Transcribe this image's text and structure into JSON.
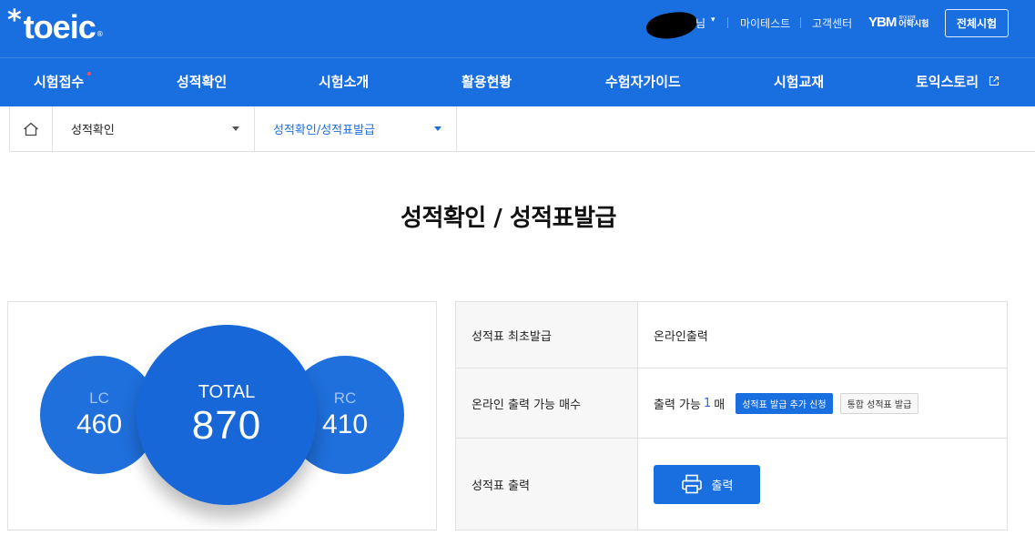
{
  "header": {
    "logo_text": "toeic",
    "logo_star": "*",
    "logo_reg": "®",
    "user_suffix": "님",
    "user_caret": "▾",
    "links": [
      "마이테스트",
      "고객센터"
    ],
    "ybm_mark": "YBM",
    "ybm_small": "와이비엠",
    "ybm_label": "어학시험",
    "all_exams_button": "전체시험"
  },
  "nav": {
    "items": [
      {
        "label": "시험접수",
        "dot": true
      },
      {
        "label": "성적확인"
      },
      {
        "label": "시험소개"
      },
      {
        "label": "활용현황"
      },
      {
        "label": "수험자가이드"
      },
      {
        "label": "시험교재"
      },
      {
        "label": "토익스토리",
        "external": true
      }
    ]
  },
  "breadcrumb": {
    "level1": "성적확인",
    "level2": "성적확인/성적표발급"
  },
  "page": {
    "title": "성적확인 / 성적표발급"
  },
  "scores": {
    "lc_label": "LC",
    "lc_score": "460",
    "total_label": "TOTAL",
    "total_score": "870",
    "rc_label": "RC",
    "rc_score": "410"
  },
  "info": {
    "row1_label": "성적표 최초발급",
    "row1_value": "온라인출력",
    "row2_label": "온라인 출력 가능 매수",
    "row2_prefix": "출력 가능",
    "row2_count": "1",
    "row2_unit": "매",
    "add_request_button": "성적표 발급 추가 신청",
    "integrated_button": "통합 성적표 발급",
    "row3_label": "성적표 출력",
    "print_button": "출력"
  },
  "colors": {
    "brand_blue": "#1a6fe0",
    "badge_red": "#ff4c4c"
  }
}
